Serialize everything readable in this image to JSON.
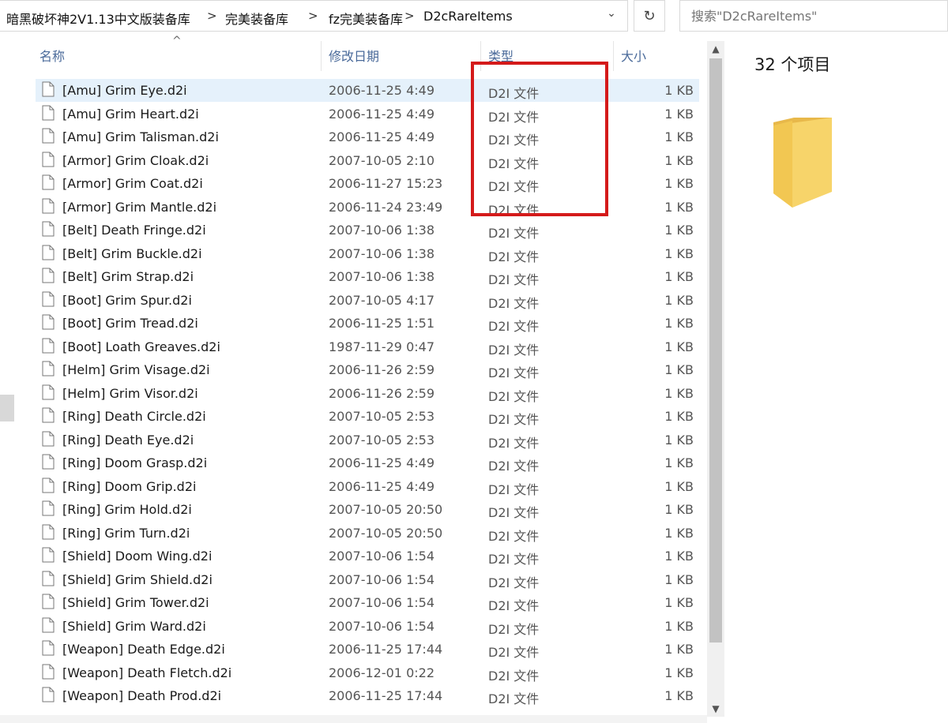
{
  "breadcrumb": {
    "items": [
      "暗黑破坏神2V1.13中文版装备库",
      "完美装备库",
      "fz完美装备库",
      "D2cRareItems"
    ]
  },
  "search": {
    "placeholder": "搜索\"D2cRareItems\""
  },
  "columns": {
    "name": "名称",
    "date": "修改日期",
    "type": "类型",
    "size": "大小"
  },
  "files": [
    {
      "name": "[Amu] Grim Eye.d2i",
      "date": "2006-11-25 4:49",
      "type": "D2I 文件",
      "size": "1 KB"
    },
    {
      "name": "[Amu] Grim Heart.d2i",
      "date": "2006-11-25 4:49",
      "type": "D2I 文件",
      "size": "1 KB"
    },
    {
      "name": "[Amu] Grim Talisman.d2i",
      "date": "2006-11-25 4:49",
      "type": "D2I 文件",
      "size": "1 KB"
    },
    {
      "name": "[Armor] Grim Cloak.d2i",
      "date": "2007-10-05 2:10",
      "type": "D2I 文件",
      "size": "1 KB"
    },
    {
      "name": "[Armor] Grim Coat.d2i",
      "date": "2006-11-27 15:23",
      "type": "D2I 文件",
      "size": "1 KB"
    },
    {
      "name": "[Armor] Grim Mantle.d2i",
      "date": "2006-11-24 23:49",
      "type": "D2I 文件",
      "size": "1 KB"
    },
    {
      "name": "[Belt] Death Fringe.d2i",
      "date": "2007-10-06 1:38",
      "type": "D2I 文件",
      "size": "1 KB"
    },
    {
      "name": "[Belt] Grim Buckle.d2i",
      "date": "2007-10-06 1:38",
      "type": "D2I 文件",
      "size": "1 KB"
    },
    {
      "name": "[Belt] Grim Strap.d2i",
      "date": "2007-10-06 1:38",
      "type": "D2I 文件",
      "size": "1 KB"
    },
    {
      "name": "[Boot] Grim Spur.d2i",
      "date": "2007-10-05 4:17",
      "type": "D2I 文件",
      "size": "1 KB"
    },
    {
      "name": "[Boot] Grim Tread.d2i",
      "date": "2006-11-25 1:51",
      "type": "D2I 文件",
      "size": "1 KB"
    },
    {
      "name": "[Boot] Loath Greaves.d2i",
      "date": "1987-11-29 0:47",
      "type": "D2I 文件",
      "size": "1 KB"
    },
    {
      "name": "[Helm] Grim Visage.d2i",
      "date": "2006-11-26 2:59",
      "type": "D2I 文件",
      "size": "1 KB"
    },
    {
      "name": "[Helm] Grim Visor.d2i",
      "date": "2006-11-26 2:59",
      "type": "D2I 文件",
      "size": "1 KB"
    },
    {
      "name": "[Ring] Death Circle.d2i",
      "date": "2007-10-05 2:53",
      "type": "D2I 文件",
      "size": "1 KB"
    },
    {
      "name": "[Ring] Death Eye.d2i",
      "date": "2007-10-05 2:53",
      "type": "D2I 文件",
      "size": "1 KB"
    },
    {
      "name": "[Ring] Doom Grasp.d2i",
      "date": "2006-11-25 4:49",
      "type": "D2I 文件",
      "size": "1 KB"
    },
    {
      "name": "[Ring] Doom Grip.d2i",
      "date": "2006-11-25 4:49",
      "type": "D2I 文件",
      "size": "1 KB"
    },
    {
      "name": "[Ring] Grim Hold.d2i",
      "date": "2007-10-05 20:50",
      "type": "D2I 文件",
      "size": "1 KB"
    },
    {
      "name": "[Ring] Grim Turn.d2i",
      "date": "2007-10-05 20:50",
      "type": "D2I 文件",
      "size": "1 KB"
    },
    {
      "name": "[Shield] Doom Wing.d2i",
      "date": "2007-10-06 1:54",
      "type": "D2I 文件",
      "size": "1 KB"
    },
    {
      "name": "[Shield] Grim Shield.d2i",
      "date": "2007-10-06 1:54",
      "type": "D2I 文件",
      "size": "1 KB"
    },
    {
      "name": "[Shield] Grim Tower.d2i",
      "date": "2007-10-06 1:54",
      "type": "D2I 文件",
      "size": "1 KB"
    },
    {
      "name": "[Shield] Grim Ward.d2i",
      "date": "2007-10-06 1:54",
      "type": "D2I 文件",
      "size": "1 KB"
    },
    {
      "name": "[Weapon] Death Edge.d2i",
      "date": "2006-11-25 17:44",
      "type": "D2I 文件",
      "size": "1 KB"
    },
    {
      "name": "[Weapon] Death Fletch.d2i",
      "date": "2006-12-01 0:22",
      "type": "D2I 文件",
      "size": "1 KB"
    },
    {
      "name": "[Weapon] Death Prod.d2i",
      "date": "2006-11-25 17:44",
      "type": "D2I 文件",
      "size": "1 KB"
    }
  ],
  "details": {
    "item_count": "32 个项目"
  },
  "colors": {
    "highlight": "#d41a1a",
    "header_text": "#4a6a9a",
    "selected_row": "#e5f1fb",
    "folder": "#f5cd5a"
  }
}
